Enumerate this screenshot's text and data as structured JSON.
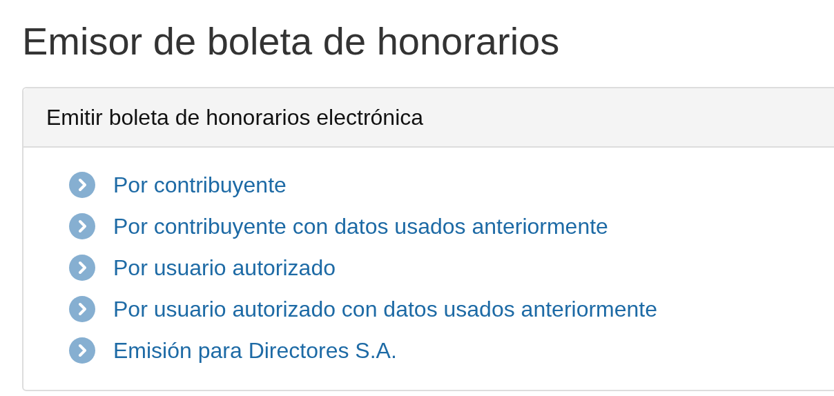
{
  "title": "Emisor de boleta de honorarios",
  "panel": {
    "heading": "Emitir boleta de honorarios electrónica",
    "links": [
      {
        "label": "Por contribuyente"
      },
      {
        "label": "Por contribuyente con datos usados anteriormente"
      },
      {
        "label": "Por usuario autorizado"
      },
      {
        "label": "Por usuario autorizado con datos usados anteriormente"
      },
      {
        "label": "Emisión para Directores S.A."
      }
    ]
  }
}
